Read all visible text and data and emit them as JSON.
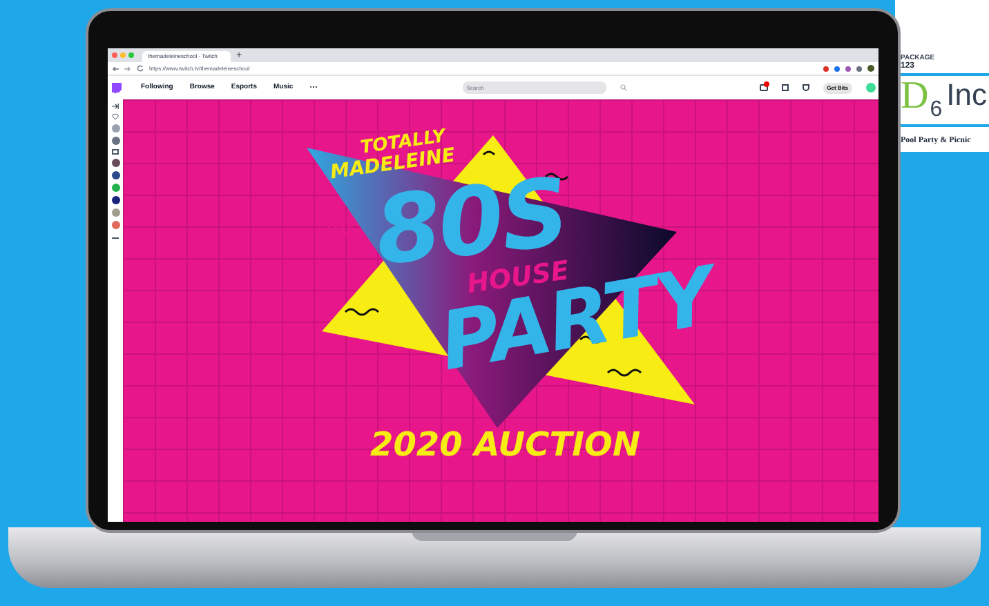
{
  "browser": {
    "tabs": [
      {
        "title": "themadeleineschool - Twitch",
        "selected": true
      }
    ],
    "new_tab": "+",
    "url": "https://www.twitch.tv/themadeleineschool"
  },
  "site_nav": {
    "items": [
      {
        "label": "Following"
      },
      {
        "label": "Browse"
      },
      {
        "label": "Esports"
      },
      {
        "label": "Music"
      }
    ],
    "more": "···",
    "search": {
      "placeholder": "Search"
    },
    "get_bits": "Get Bits"
  },
  "banner": {
    "tagline": [
      "TOTALLY",
      "MADELEINE"
    ],
    "title": "80S",
    "subtitle": "HOUSE",
    "title_2": "PARTY",
    "footer": "2020 AUCTION"
  },
  "background_page": {
    "label": "PACKAGE",
    "number": "123",
    "logo_letter": "D",
    "logo_subscript": "6",
    "logo_text": "Inc",
    "heading": "Pool Party & Picnic"
  }
}
